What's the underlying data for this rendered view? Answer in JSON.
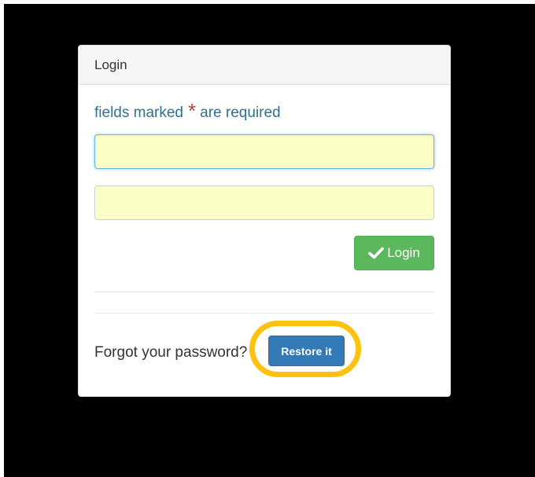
{
  "panel": {
    "title": "Login"
  },
  "form": {
    "required_prefix": "fields marked",
    "required_star": "*",
    "required_suffix": "are required",
    "username": {
      "value": "",
      "placeholder": ""
    },
    "password": {
      "value": "",
      "placeholder": ""
    },
    "login_label": "Login"
  },
  "forgot": {
    "text": "Forgot your password?",
    "restore_label": "Restore it"
  },
  "colors": {
    "background": "#000000",
    "info_text": "#31708f",
    "required_star": "#a94442",
    "field_fill": "#fbffc8",
    "login_button": "#5cb85c",
    "restore_button": "#337ab7",
    "highlight": "#ffc20e"
  },
  "icons": {
    "login": "check-icon"
  }
}
